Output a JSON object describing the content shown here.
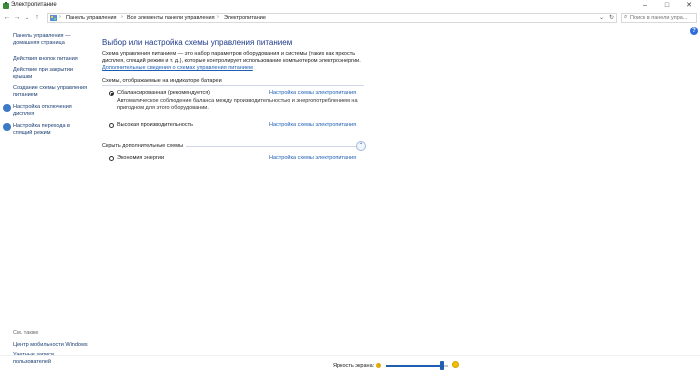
{
  "window": {
    "title": "Электропитание"
  },
  "address": {
    "crumbs": [
      "Панель управления",
      "Все элементы панели управления",
      "Электропитание"
    ],
    "search_placeholder": "Поиск в панели упра..."
  },
  "sidebar": {
    "home_link": "Панель управления — домашняя страница",
    "links": [
      "Действия кнопок питания",
      "Действие при закрытии крышки",
      "Создание схемы управления питанием",
      "Настройка отключения дисплея",
      "Настройка перехода в спящий режим"
    ],
    "see_also_label": "См. также",
    "see_also_links": [
      "Центр мобильности Windows",
      "Учетные записи пользователей"
    ]
  },
  "main": {
    "heading": "Выбор или настройка схемы управления питанием",
    "description": "Схема управления питанием — это набор параметров оборудования и системы (таких как яркость дисплея, спящий режим и т. д.), которые контролирует использование компьютером электроэнергии.",
    "description_link": "Дополнительные сведения о схемах управления питанием",
    "section_label": "Схемы, отображаемые на индикаторе батареи",
    "plans": [
      {
        "name": "Сбалансированная (рекомендуется)",
        "description": "Автоматическое соблюдение баланса между производительностью и энергопотреблением на пригодном для этого оборудовании.",
        "link": "Настройка схемы электропитания",
        "selected": true
      },
      {
        "name": "Высокая производительность",
        "description": "",
        "link": "Настройка схемы электропитания",
        "selected": false
      }
    ],
    "hidden_section_label": "Скрыть дополнительные схемы",
    "hidden_plans": [
      {
        "name": "Экономия энергии",
        "link": "Настройка схемы электропитания",
        "selected": false
      }
    ]
  },
  "footer": {
    "brightness_label": "Яркость экрана:",
    "brightness_level": 0.9
  },
  "colors": {
    "link": "#1e5fb4",
    "heading": "#1e3a8a",
    "accent": "#1e5fb4"
  }
}
